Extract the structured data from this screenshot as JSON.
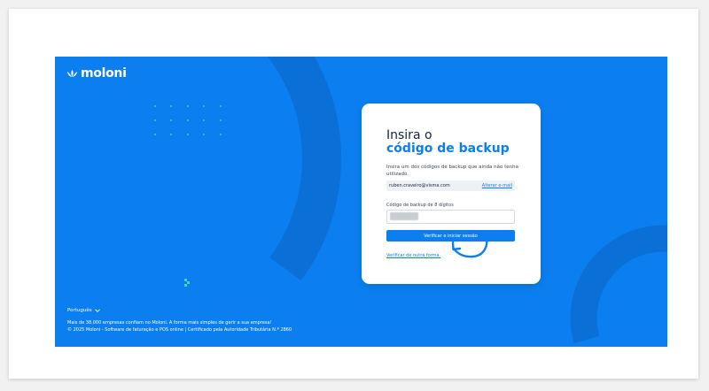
{
  "brand": {
    "name": "moloni",
    "color": "#0b7ff0",
    "logo_icon": "lotus-flower-icon"
  },
  "language": {
    "label": "Português",
    "icon": "chevron-down-icon"
  },
  "footer": {
    "line1": "Mais de 38.000 empresas confiam no Moloni. A forma mais simples de gerir a sua empresa!",
    "line2": "© 2025 Moloni - Software de faturação e POS online | Certificado pela Autoridade Tributária N.º 2860"
  },
  "card": {
    "title_line1": "Insira o",
    "title_line2": "código de backup",
    "description": "Insira um dos códigos de backup que ainda não tenha utilizado.",
    "email": "ruben.craveiro@visma.com",
    "change_email_label": "Alterar e-mail",
    "code_label": "Código de backup de 8 dígitos",
    "code_value": "",
    "submit_label": "Verificar e iniciar sessão",
    "other_method_label": "Verificar de outra forma."
  }
}
